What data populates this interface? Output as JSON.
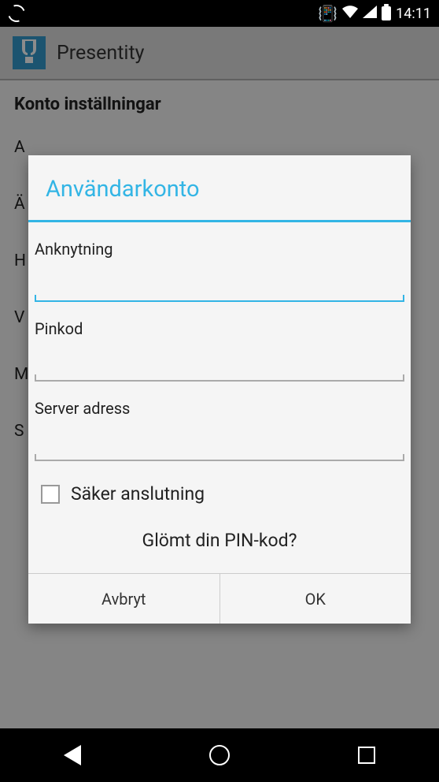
{
  "status": {
    "time": "14:11"
  },
  "actionbar": {
    "title": "Presentity"
  },
  "settings": {
    "header": "Konto inställningar",
    "items": [
      "A",
      "Ä",
      "H",
      "V",
      "M",
      "S"
    ]
  },
  "dialog": {
    "title": "Användarkonto",
    "extension_label": "Anknytning",
    "extension_value": "",
    "pin_label": "Pinkod",
    "pin_value": "",
    "server_label": "Server adress",
    "server_value": "",
    "secure_label": "Säker anslutning",
    "forgot": "Glömt din PIN-kod?",
    "cancel": "Avbryt",
    "ok": "OK"
  }
}
